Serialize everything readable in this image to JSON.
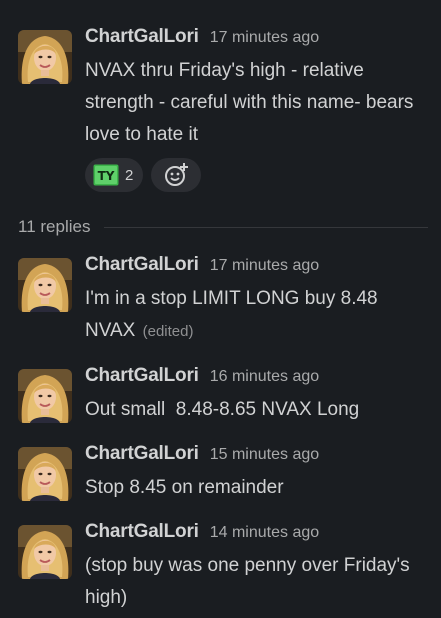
{
  "parent": {
    "author": "ChartGalLori",
    "time": "17 minutes ago",
    "text": "NVAX thru Friday's high - relative strength - careful with this name- bears love to hate it",
    "reaction": {
      "emoji": "TY",
      "count": "2"
    },
    "add_reaction_icon": "add-reaction-smiley-icon"
  },
  "replies_label": "11 replies",
  "replies": [
    {
      "author": "ChartGalLori",
      "time": "17 minutes ago",
      "text": "I'm in a stop LIMIT LONG buy 8.48 NVAX",
      "edited": "(edited)"
    },
    {
      "author": "ChartGalLori",
      "time": "16 minutes ago",
      "text": "Out small  8.48-8.65 NVAX Long"
    },
    {
      "author": "ChartGalLori",
      "time": "15 minutes ago",
      "text": "Stop 8.45 on remainder"
    },
    {
      "author": "ChartGalLori",
      "time": "14 minutes ago",
      "text": "(stop buy was one penny over Friday's high)"
    }
  ],
  "colors": {
    "background": "#1a1d21",
    "text": "#d1d2d3",
    "muted": "#a9aaab",
    "reaction_bg": "#2c2e33"
  }
}
